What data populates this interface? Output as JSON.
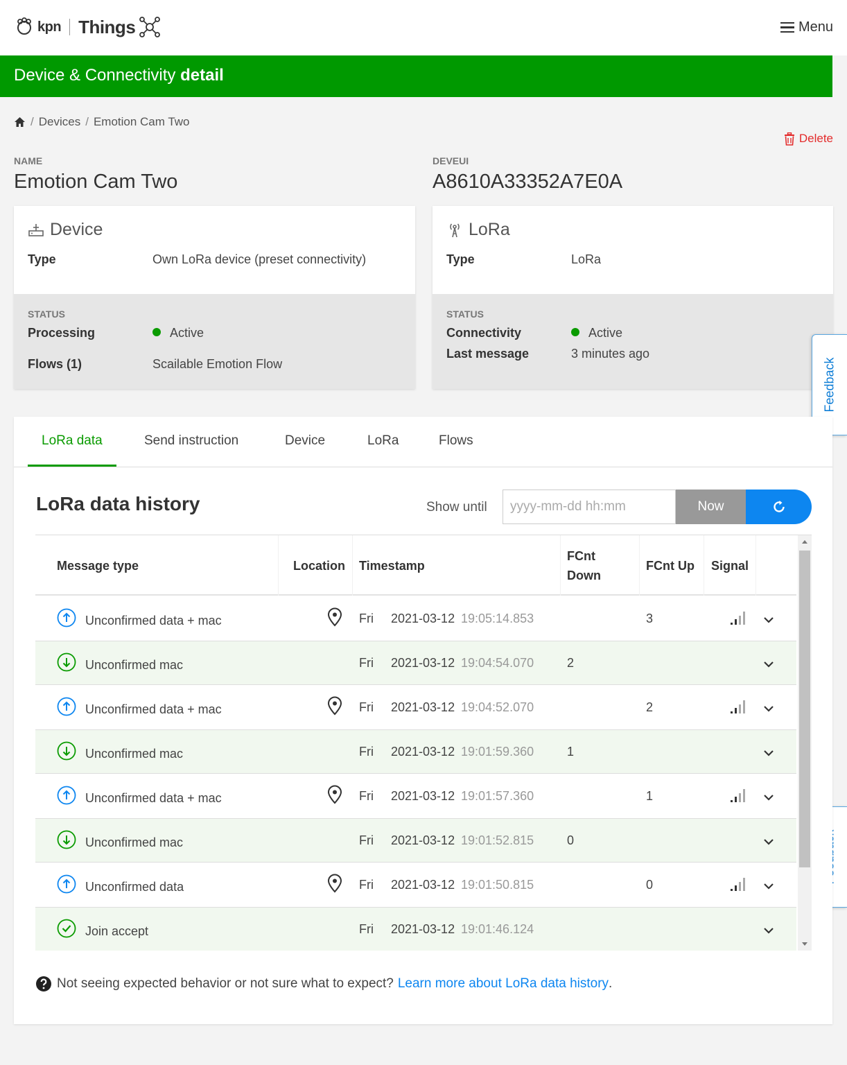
{
  "header": {
    "brand": "kpn",
    "product": "Things",
    "menu_label": "Menu"
  },
  "banner": {
    "title_prefix": "Device & Connectivity ",
    "title_bold": "detail"
  },
  "breadcrumb": {
    "items": [
      "Devices",
      "Emotion Cam Two"
    ]
  },
  "actions": {
    "delete_label": "Delete"
  },
  "device": {
    "name_label": "NAME",
    "name": "Emotion Cam Two",
    "deveui_label": "DEVEUI",
    "deveui": "A8610A33352A7E0A"
  },
  "device_card": {
    "title": "Device",
    "type_label": "Type",
    "type_value": "Own LoRa device (preset connectivity)",
    "status_label": "STATUS",
    "processing_label": "Processing",
    "processing_value": "Active",
    "flows_label": "Flows (1)",
    "flows_value": "Scailable Emotion Flow"
  },
  "lora_card": {
    "title": "LoRa",
    "type_label": "Type",
    "type_value": "LoRa",
    "status_label": "STATUS",
    "connectivity_label": "Connectivity",
    "connectivity_value": "Active",
    "last_message_label": "Last message",
    "last_message_value": "3 minutes ago"
  },
  "feedback_label": "Feedback",
  "tabs": [
    {
      "label": "LoRa data",
      "active": true
    },
    {
      "label": "Send instruction",
      "active": false
    },
    {
      "label": "Device",
      "active": false
    },
    {
      "label": "LoRa",
      "active": false
    },
    {
      "label": "Flows",
      "active": false
    }
  ],
  "history": {
    "title": "LoRa data history",
    "show_until_label": "Show until",
    "date_placeholder": "yyyy-mm-dd hh:mm",
    "now_label": "Now"
  },
  "table": {
    "columns": [
      "Message type",
      "Location",
      "Timestamp",
      "FCnt Down",
      "FCnt Up",
      "Signal"
    ],
    "rows": [
      {
        "direction": "up",
        "type": "Unconfirmed data + mac",
        "location": true,
        "day": "Fri",
        "date": "2021-03-12",
        "time": "19:05:14.853",
        "fcnt_down": "",
        "fcnt_up": "3",
        "signal": true
      },
      {
        "direction": "down",
        "type": "Unconfirmed mac",
        "location": false,
        "day": "Fri",
        "date": "2021-03-12",
        "time": "19:04:54.070",
        "fcnt_down": "2",
        "fcnt_up": "",
        "signal": false
      },
      {
        "direction": "up",
        "type": "Unconfirmed data + mac",
        "location": true,
        "day": "Fri",
        "date": "2021-03-12",
        "time": "19:04:52.070",
        "fcnt_down": "",
        "fcnt_up": "2",
        "signal": true
      },
      {
        "direction": "down",
        "type": "Unconfirmed mac",
        "location": false,
        "day": "Fri",
        "date": "2021-03-12",
        "time": "19:01:59.360",
        "fcnt_down": "1",
        "fcnt_up": "",
        "signal": false
      },
      {
        "direction": "up",
        "type": "Unconfirmed data + mac",
        "location": true,
        "day": "Fri",
        "date": "2021-03-12",
        "time": "19:01:57.360",
        "fcnt_down": "",
        "fcnt_up": "1",
        "signal": true
      },
      {
        "direction": "down",
        "type": "Unconfirmed mac",
        "location": false,
        "day": "Fri",
        "date": "2021-03-12",
        "time": "19:01:52.815",
        "fcnt_down": "0",
        "fcnt_up": "",
        "signal": false
      },
      {
        "direction": "up",
        "type": "Unconfirmed data",
        "location": true,
        "day": "Fri",
        "date": "2021-03-12",
        "time": "19:01:50.815",
        "fcnt_down": "",
        "fcnt_up": "0",
        "signal": true
      },
      {
        "direction": "join",
        "type": "Join accept",
        "location": false,
        "day": "Fri",
        "date": "2021-03-12",
        "time": "19:01:46.124",
        "fcnt_down": "",
        "fcnt_up": "",
        "signal": false
      }
    ]
  },
  "help": {
    "text": "Not seeing expected behavior or not sure what to expect?",
    "link": "Learn more about LoRa data history",
    "suffix": "."
  },
  "colors": {
    "brand_green": "#009900",
    "accent_blue": "#0d86f0",
    "active_dot": "#0a9b00",
    "delete_red": "#e32b2b",
    "downlink_row_bg": "#f1f8ef"
  }
}
